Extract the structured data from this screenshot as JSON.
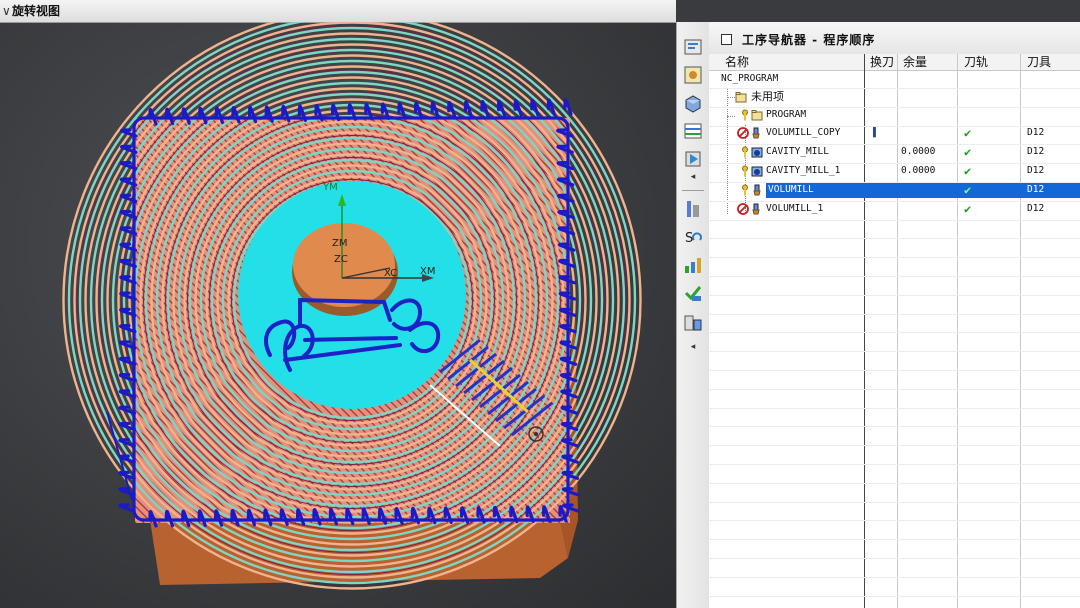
{
  "viewport": {
    "title": "旋转视图",
    "axes": {
      "ym": "YM",
      "zm": "ZM",
      "zc": "ZC",
      "xm": "XM",
      "xc": "XC"
    }
  },
  "navigator": {
    "title": "工序导航器 - 程序顺序",
    "columns": [
      "名称",
      "换刀",
      "余量",
      "刀轨",
      "刀具"
    ],
    "rows": [
      {
        "name": "NC_PROGRAM",
        "tool_change": "",
        "allowance": "",
        "path": "",
        "tool": "",
        "icon": "none"
      },
      {
        "name": "未用项",
        "tool_change": "",
        "allowance": "",
        "path": "",
        "tool": "",
        "icon": "folder"
      },
      {
        "name": "PROGRAM",
        "tool_change": "",
        "allowance": "",
        "path": "",
        "tool": "",
        "icon": "folder-key"
      },
      {
        "name": "VOLUMILL_COPY",
        "tool_change": "▌",
        "allowance": "",
        "path": "✔",
        "tool": "D12",
        "icon": "no-op"
      },
      {
        "name": "CAVITY_MILL",
        "tool_change": "",
        "allowance": "0.0000",
        "path": "✔",
        "tool": "D12",
        "icon": "key-op"
      },
      {
        "name": "CAVITY_MILL_1",
        "tool_change": "",
        "allowance": "0.0000",
        "path": "✔",
        "tool": "D12",
        "icon": "key-op"
      },
      {
        "name": "VOLUMILL",
        "tool_change": "",
        "allowance": "",
        "path": "✔",
        "tool": "D12",
        "icon": "key-op",
        "selected": true
      },
      {
        "name": "VOLUMILL_1",
        "tool_change": "",
        "allowance": "",
        "path": "✔",
        "tool": "D12",
        "icon": "no-op"
      }
    ]
  },
  "colors": {
    "selection": "#1467d6",
    "check": "#1a9c1a",
    "toolpath": "#1a1ac8",
    "stock": "#e3917a",
    "floor": "#22dfe8"
  }
}
